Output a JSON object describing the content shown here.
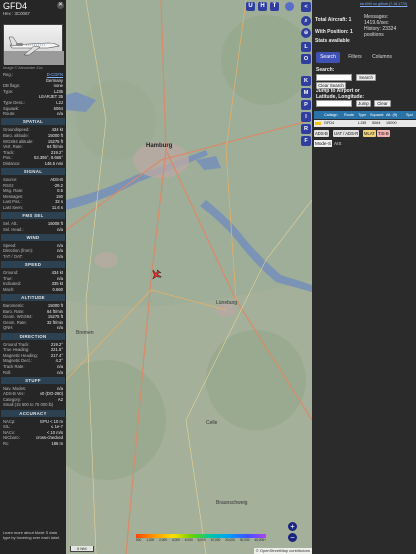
{
  "aircraft": {
    "callsign": "GFD4",
    "hex_label": "Hex : 3C0067",
    "photo_credit": "Image © Alexander Zox",
    "close_icon": "✕"
  },
  "details": [
    {
      "k": "Reg.:",
      "v": "D-CGFN",
      "link": true
    },
    {
      "k": "",
      "v": "Germany"
    },
    {
      "k": "DB flags:",
      "v": "none"
    },
    {
      "k": "Type:",
      "v": "LJ35"
    },
    {
      "k": "",
      "v": "LEARJET 35"
    },
    {
      "k": "Type Desc.:",
      "v": "L2J"
    },
    {
      "k": "Squawk:",
      "v": "5064"
    },
    {
      "k": "Route:",
      "v": "n/a"
    }
  ],
  "sections": {
    "spatial": "SPATIAL",
    "signal": "SIGNAL",
    "fms": "FMS SEL",
    "wind": "WIND",
    "speed": "SPEED",
    "altitude": "ALTITUDE",
    "direction": "DIRECTION",
    "stuff": "STUFF",
    "accuracy": "ACCURACY"
  },
  "spatial": [
    {
      "k": "Groundspeed:",
      "v": "434 kt"
    },
    {
      "k": "Baro. altitude:",
      "v": "15000 ft"
    },
    {
      "k": "WGS84 altitude:",
      "v": "15275 ft"
    },
    {
      "k": "Vert. Rate:",
      "v": "64 ft/min"
    },
    {
      "k": "Track:",
      "v": "219.2°"
    },
    {
      "k": "Pos.:",
      "v": "53.395°, 9.665°"
    },
    {
      "k": "Distance:",
      "v": "146.5 nmi"
    }
  ],
  "signal": [
    {
      "k": "Source:",
      "v": "ADS-B"
    },
    {
      "k": "RSSI:",
      "v": "-29.2"
    },
    {
      "k": "Msg. Rate:",
      "v": "0.5"
    },
    {
      "k": "Messages:",
      "v": "150"
    },
    {
      "k": "Last Pos.:",
      "v": "32 s"
    },
    {
      "k": "Last Seen:",
      "v": "11.6 s"
    }
  ],
  "fms": [
    {
      "k": "Sel. Alt.:",
      "v": "15008 ft"
    },
    {
      "k": "Sel. Head.:",
      "v": "n/a"
    }
  ],
  "wind": [
    {
      "k": "Speed:",
      "v": "n/a"
    },
    {
      "k": "Direction (from):",
      "v": "n/a"
    },
    {
      "k": "TAT / OAT:",
      "v": "n/a"
    }
  ],
  "speed": [
    {
      "k": "Ground:",
      "v": "434 kt"
    },
    {
      "k": "True:",
      "v": "n/a"
    },
    {
      "k": "Indicated:",
      "v": "335 kt"
    },
    {
      "k": "Mach:",
      "v": "0.660"
    }
  ],
  "altitude": [
    {
      "k": "Barometric:",
      "v": "15000 ft"
    },
    {
      "k": "Baro. Rate:",
      "v": "64 ft/min"
    },
    {
      "k": "Geom. WGS84:",
      "v": "15275 ft"
    },
    {
      "k": "Geom. Rate:",
      "v": "32 ft/min"
    },
    {
      "k": "QNH:",
      "v": "n/a"
    }
  ],
  "direction": [
    {
      "k": "Ground Track:",
      "v": "219.2°"
    },
    {
      "k": "True Heading:",
      "v": "221.5°"
    },
    {
      "k": "Magnetic Heading:",
      "v": "217.4°"
    },
    {
      "k": "Magnetic Decl.:",
      "v": "4.2°"
    },
    {
      "k": "Track Rate:",
      "v": "n/a"
    },
    {
      "k": "Roll:",
      "v": "n/a"
    }
  ],
  "stuff": [
    {
      "k": "Nav. Modes:",
      "v": "n/a"
    },
    {
      "k": "ADS-B Ver.:",
      "v": "v0 (DO-260)"
    },
    {
      "k": "Category:",
      "v": "A2"
    },
    {
      "k": "Small (15 500 to 75 000 lb)",
      "v": ""
    }
  ],
  "accuracy": [
    {
      "k": "NACp:",
      "v": "EPU < 10 m"
    },
    {
      "k": "SIL:",
      "v": "≤ 1e-7"
    },
    {
      "k": "NACv:",
      "v": "< 10 m/s"
    },
    {
      "k": "NICbaro:",
      "v": "cross-checked"
    },
    {
      "k": "Rc:",
      "v": "186 m"
    }
  ],
  "left_note": "Learn more about Mode S data type by hovering over each label.",
  "map": {
    "cities": [
      {
        "name": "Hamburg",
        "big": true
      },
      {
        "name": "Lüneburg",
        "big": false
      },
      {
        "name": "Bremen",
        "big": false
      },
      {
        "name": "Celle",
        "big": false
      },
      {
        "name": "Braunschweig",
        "big": false
      }
    ],
    "top_buttons": [
      "U",
      "H",
      "T"
    ],
    "zoom_in": "+",
    "zoom_out": "−",
    "legend_ticks": [
      "500",
      "1,000",
      "2,000",
      "4,000",
      "6,000",
      "8,000",
      "10,000",
      "20,000",
      "30,000",
      "40,000+"
    ],
    "attribution": "© OpenStreetMap contributors",
    "scale": "5 NM"
  },
  "column_buttons": [
    "<",
    "⌕",
    "⊕",
    "L",
    "O",
    "K",
    "M",
    "P",
    "I",
    "R",
    "F"
  ],
  "sidebar": {
    "version_link": "tar1090 on github (7.18.1770)",
    "total_aircraft": "Total Aircraft: 1",
    "messages": "Messages: 1419.6/sec",
    "with_position": "With Position: 1",
    "history": "History: 23324 positions",
    "stats_available": "Stats available",
    "tabs": [
      "Search",
      "Filters",
      "Columns"
    ],
    "search_label": "Search:",
    "search_button": "Search",
    "clear_search": "Clear Search",
    "jump_label": "Jump to Airport or Latitude, Longitude:",
    "jump_button": "Jump",
    "clear_button": "Clear",
    "columns": [
      "Callsign",
      "Route",
      "Type",
      "Squawk",
      "Alt. (ft)",
      "Spd"
    ],
    "row": [
      "GFD4",
      "",
      "LJ35",
      "5064",
      "15000",
      ""
    ],
    "badges": [
      "ADS-B",
      "UAT / ADS-R",
      "MLAT",
      "TIS-B"
    ],
    "modes": [
      "Mode-S",
      "AIS"
    ]
  }
}
